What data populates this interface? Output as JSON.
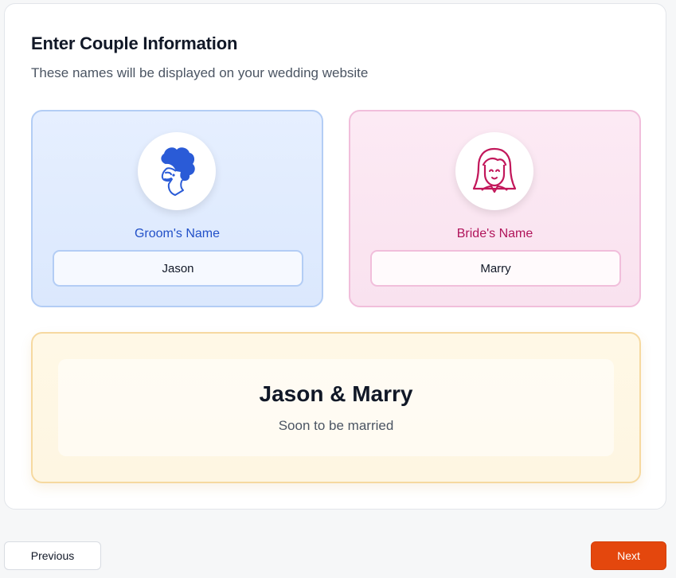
{
  "header": {
    "title": "Enter Couple Information",
    "subtitle": "These names will be displayed on your wedding website"
  },
  "groom": {
    "label": "Groom's Name",
    "value": "Jason",
    "icon": "groom-avatar-icon",
    "accent": "#2250c8"
  },
  "bride": {
    "label": "Bride's Name",
    "value": "Marry",
    "icon": "bride-avatar-icon",
    "accent": "#c2185b"
  },
  "preview": {
    "names": "Jason & Marry",
    "tagline": "Soon to be married"
  },
  "nav": {
    "previous_label": "Previous",
    "next_label": "Next",
    "next_color": "#e4470d"
  }
}
